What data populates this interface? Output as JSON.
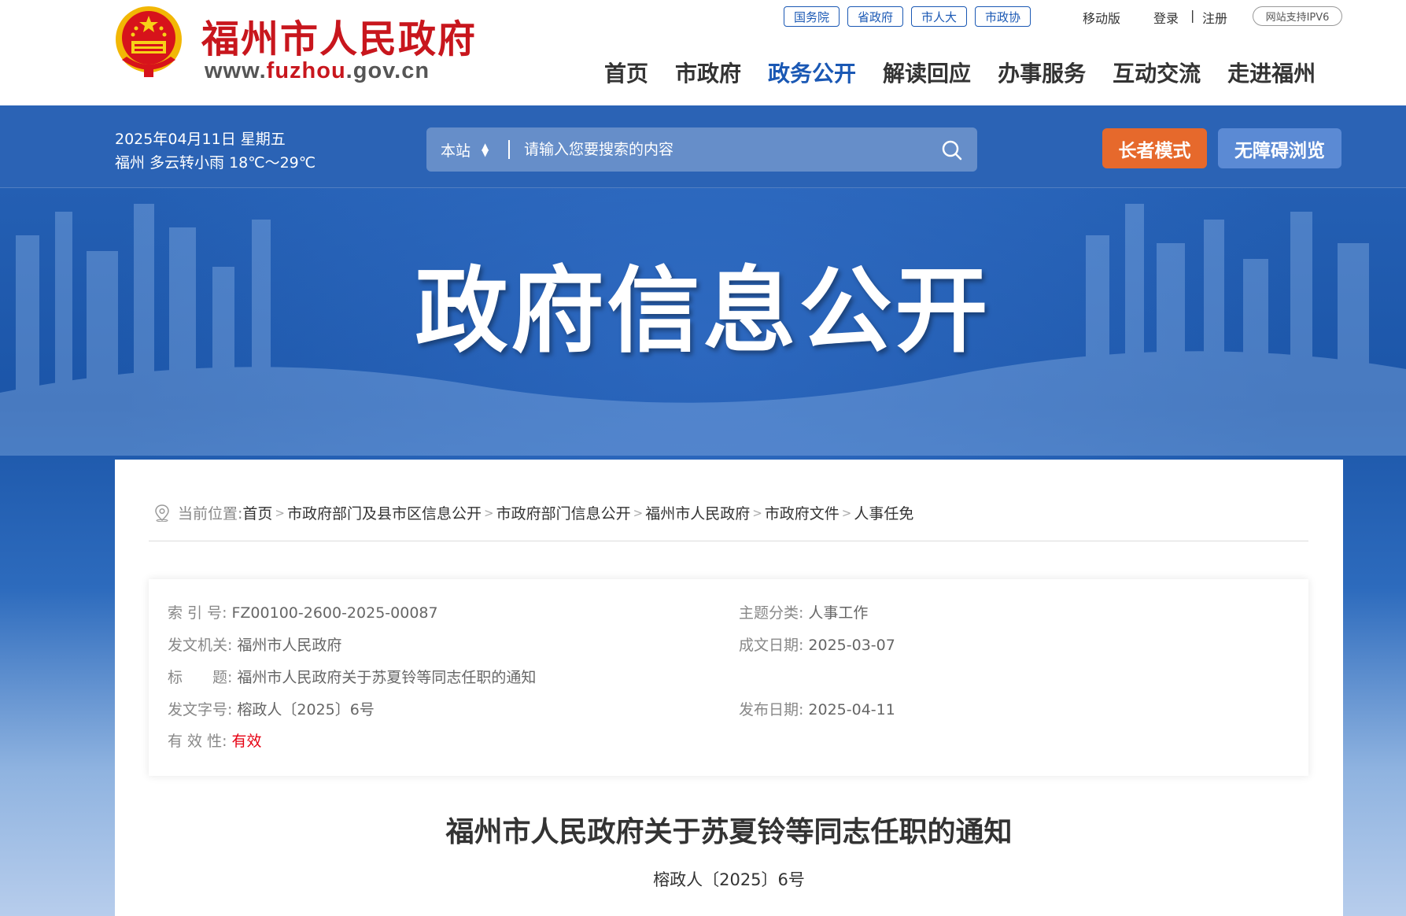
{
  "header": {
    "site_name": "福州市人民政府",
    "url_prefix": "www.",
    "url_highlight": "fuzhou",
    "url_suffix": ".gov.cn",
    "gov_links": [
      "国务院",
      "省政府",
      "市人大",
      "市政协"
    ],
    "mobile": "移动版",
    "login": "登录",
    "separator": "|",
    "register": "注册",
    "ipv6": "网站支持IPV6",
    "nav": [
      "首页",
      "市政府",
      "政务公开",
      "解读回应",
      "办事服务",
      "互动交流",
      "走进福州"
    ],
    "nav_active_index": 2
  },
  "topbar": {
    "date": "2025年04月11日 星期五",
    "weather": "福州 多云转小雨 18℃～29℃",
    "search_scope": "本站",
    "search_placeholder": "请输入您要搜索的内容",
    "elder_mode": "长者模式",
    "accessible": "无障碍浏览"
  },
  "banner": {
    "title": "政府信息公开"
  },
  "breadcrumb": {
    "label": "当前位置:",
    "items": [
      "首页",
      "市政府部门及县市区信息公开",
      "市政府部门信息公开",
      "福州市人民政府",
      "市政府文件",
      "人事任免"
    ],
    "arrow": ">"
  },
  "meta": {
    "index_label": "索 引 号:",
    "index_value": "FZ00100-2600-2025-00087",
    "topic_label": "主题分类:",
    "topic_value": "人事工作",
    "issuer_label": "发文机关:",
    "issuer_value": "福州市人民政府",
    "date_label": "成文日期:",
    "date_value": "2025-03-07",
    "title_label": "标　　题:",
    "title_value": "福州市人民政府关于苏夏铃等同志任职的通知",
    "docno_label": "发文字号:",
    "docno_value": "榕政人〔2025〕6号",
    "pub_label": "发布日期:",
    "pub_value": "2025-04-11",
    "valid_label": "有 效 性:",
    "valid_value": "有效"
  },
  "document": {
    "title": "福州市人民政府关于苏夏铃等同志任职的通知",
    "number": "榕政人〔2025〕6号"
  },
  "colors": {
    "brand_red": "#c8161d",
    "brand_blue": "#1a58b4",
    "elder_orange": "#e6692c",
    "valid_red": "#e60012"
  }
}
